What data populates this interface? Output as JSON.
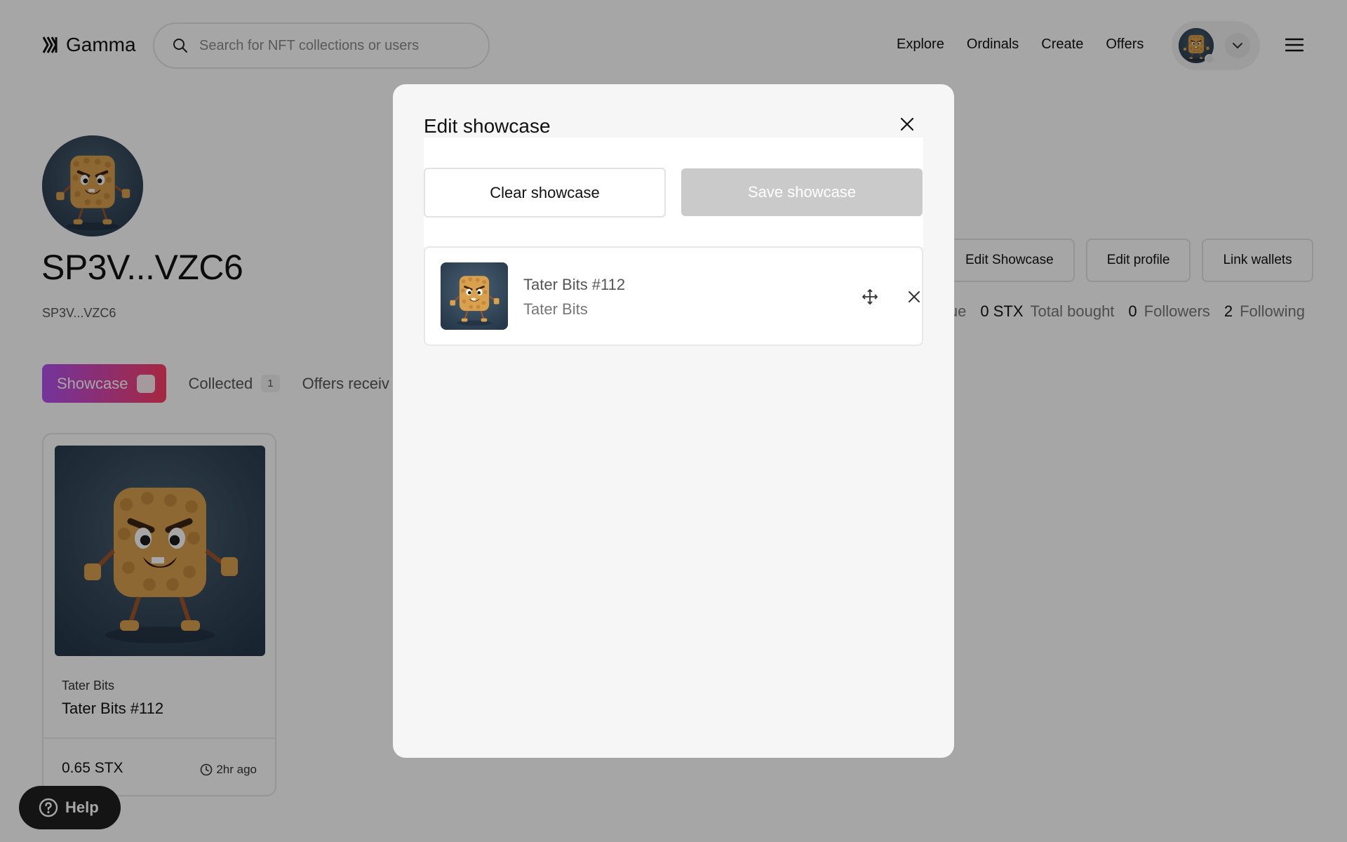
{
  "header": {
    "logo_text": "Gamma",
    "search_placeholder": "Search for NFT collections or users",
    "nav": [
      "Explore",
      "Ordinals",
      "Create",
      "Offers"
    ]
  },
  "profile": {
    "name": "SP3V...VZC6",
    "address": "SP3V...VZC6",
    "actions": {
      "edit_showcase": "Edit Showcase",
      "edit_profile": "Edit profile",
      "link_wallets": "Link wallets"
    },
    "stats": {
      "partial_label": "ue",
      "total_bought_value": "0 STX",
      "total_bought_label": "Total bought",
      "followers_value": "0",
      "followers_label": "Followers",
      "following_value": "2",
      "following_label": "Following"
    }
  },
  "tabs": {
    "showcase": "Showcase",
    "collected": "Collected",
    "collected_count": "1",
    "offers": "Offers receiv"
  },
  "card": {
    "collection": "Tater Bits",
    "title": "Tater Bits #112",
    "price": "0.65 STX",
    "time": "2hr ago"
  },
  "help": {
    "label": "Help"
  },
  "modal": {
    "title": "Edit showcase",
    "clear_label": "Clear showcase",
    "save_label": "Save showcase",
    "item": {
      "title": "Tater Bits #112",
      "collection": "Tater Bits"
    }
  },
  "colors": {
    "tab_gradient_start": "#b151f0",
    "tab_gradient_end": "#ff3d65",
    "overlay": "rgba(0,0,0,0.35)",
    "save_disabled": "#cacaca"
  }
}
